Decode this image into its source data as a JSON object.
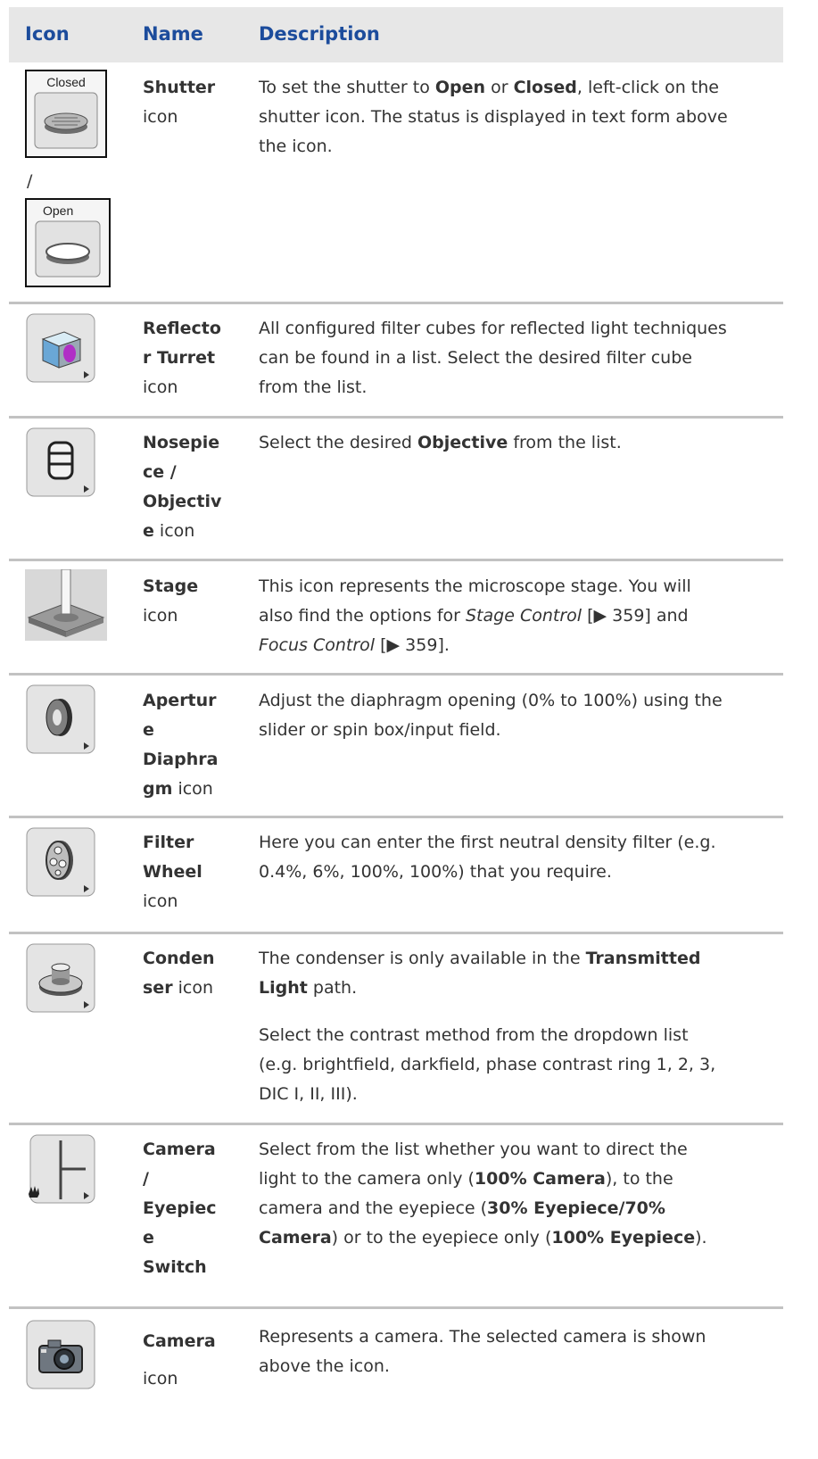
{
  "header": {
    "col_icon": "Icon",
    "col_name": "Name",
    "col_desc": "Description"
  },
  "rows": [
    {
      "name_bold": [
        "Shutter"
      ],
      "name_suffix": "icon",
      "icon_labels": {
        "closed": "Closed",
        "open": "Open",
        "separator": "/"
      },
      "desc": {
        "t1": "To set the shutter to ",
        "b1": "Open",
        "t2": " or ",
        "b2": "Closed",
        "t3": ", left-click on the",
        "t4": "shutter icon. The status is displayed in text form above",
        "t5": "the icon."
      }
    },
    {
      "name_bold": [
        "Reflecto",
        "r Turret"
      ],
      "name_suffix": "icon",
      "desc": {
        "l1": "All configured filter cubes for reflected light techniques",
        "l2": "can be found in a list. Select the desired filter cube",
        "l3": "from the list."
      }
    },
    {
      "name_bold": [
        "Nosepie",
        "ce /",
        "Objectiv",
        "e"
      ],
      "name_suffix": " icon",
      "desc": {
        "t1": "Select the desired ",
        "b1": "Objective",
        "t2": " from the list."
      }
    },
    {
      "name_bold": [
        "Stage"
      ],
      "name_suffix": "icon",
      "desc": {
        "l1": "This icon represents the microscope stage. You will",
        "t2": "also find the options for ",
        "i1": "Stage Control",
        "t3": " [▶ 359] and",
        "i2": "Focus Control",
        "t4": " [▶ 359]."
      }
    },
    {
      "name_bold": [
        "Apertur",
        "e",
        "Diaphra",
        "gm"
      ],
      "name_suffix": " icon",
      "desc": {
        "l1": "Adjust the diaphragm opening (0% to 100%) using the",
        "l2": "slider or spin box/input field."
      }
    },
    {
      "name_bold": [
        "Filter",
        "Wheel"
      ],
      "name_suffix": "icon",
      "desc": {
        "l1": "Here you can enter the first neutral density filter (e.g.",
        "l2": "0.4%, 6%, 100%, 100%) that you require."
      }
    },
    {
      "name_bold": [
        "Conden",
        "ser"
      ],
      "name_suffix": " icon",
      "desc": {
        "t1": "The condenser is only available in the ",
        "b1": "Transmitted",
        "b2": "Light",
        "t2": " path.",
        "p2l1": "Select the contrast method from the dropdown list",
        "p2l2": "(e.g. brightfield, darkfield, phase contrast ring 1, 2, 3,",
        "p2l3": "DIC I, II, III)."
      }
    },
    {
      "name_bold": [
        "Camera",
        "/",
        "Eyepiec",
        "e",
        "Switch"
      ],
      "desc": {
        "l1": "Select from the list whether you want to direct the",
        "t2": "light to the camera only (",
        "b1": "100% Camera",
        "t3": "), to the",
        "t4": "camera and the eyepiece (",
        "b2": "30% Eyepiece/70%",
        "b3": "Camera",
        "t5": ") or to the eyepiece only (",
        "b4": "100% Eyepiece",
        "t6": ")."
      }
    },
    {
      "name_bold": [
        "Camera"
      ],
      "name_suffix": "icon",
      "desc": {
        "l1": "Represents a camera. The selected camera is shown",
        "l2": "above the icon."
      }
    }
  ],
  "colors": {
    "heading": "#1c4c9c",
    "header_bg": "#e7e7e7",
    "rule": "#c2c2c2",
    "text": "#333333"
  }
}
